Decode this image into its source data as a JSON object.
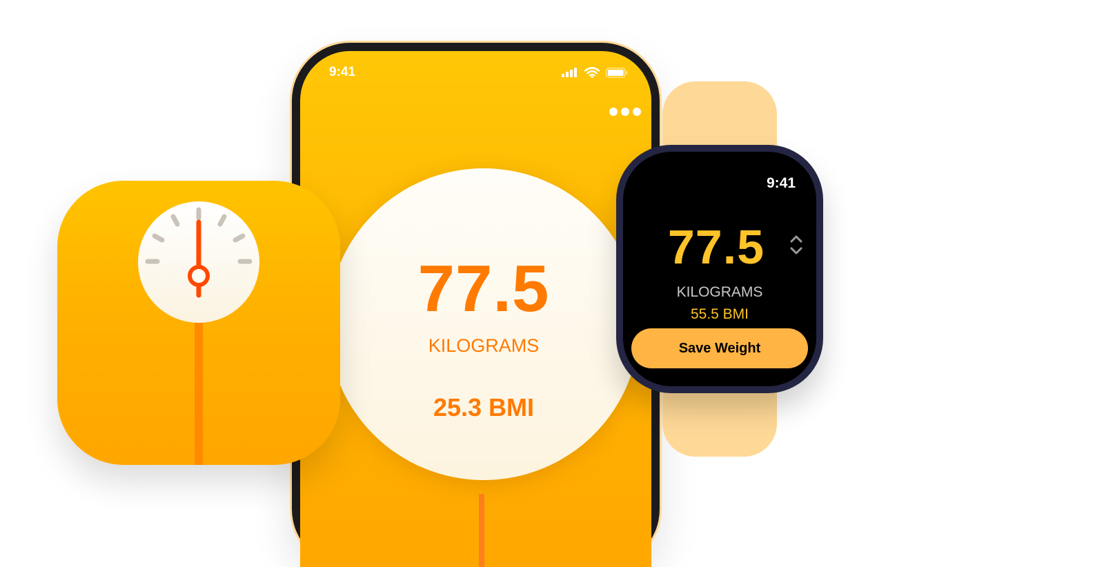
{
  "phone": {
    "status_time": "9:41",
    "weight_value": "77.5",
    "unit_label": "KILOGRAMS",
    "bmi_label": "25.3 BMI",
    "more_icon": "ellipsis-icon"
  },
  "app_icon": {
    "icon": "scale-dial-icon"
  },
  "watch": {
    "status_time": "9:41",
    "weight_value": "77.5",
    "unit_label": "KILOGRAMS",
    "bmi_label": "55.5 BMI",
    "save_label": "Save Weight",
    "crown_icon": "chevron-up-down-icon"
  },
  "colors": {
    "accent_orange": "#ff7a00",
    "yellow": "#ffb300",
    "watch_yellow": "#ffc32a",
    "save_button": "#ffb444",
    "band": "#fed896"
  }
}
